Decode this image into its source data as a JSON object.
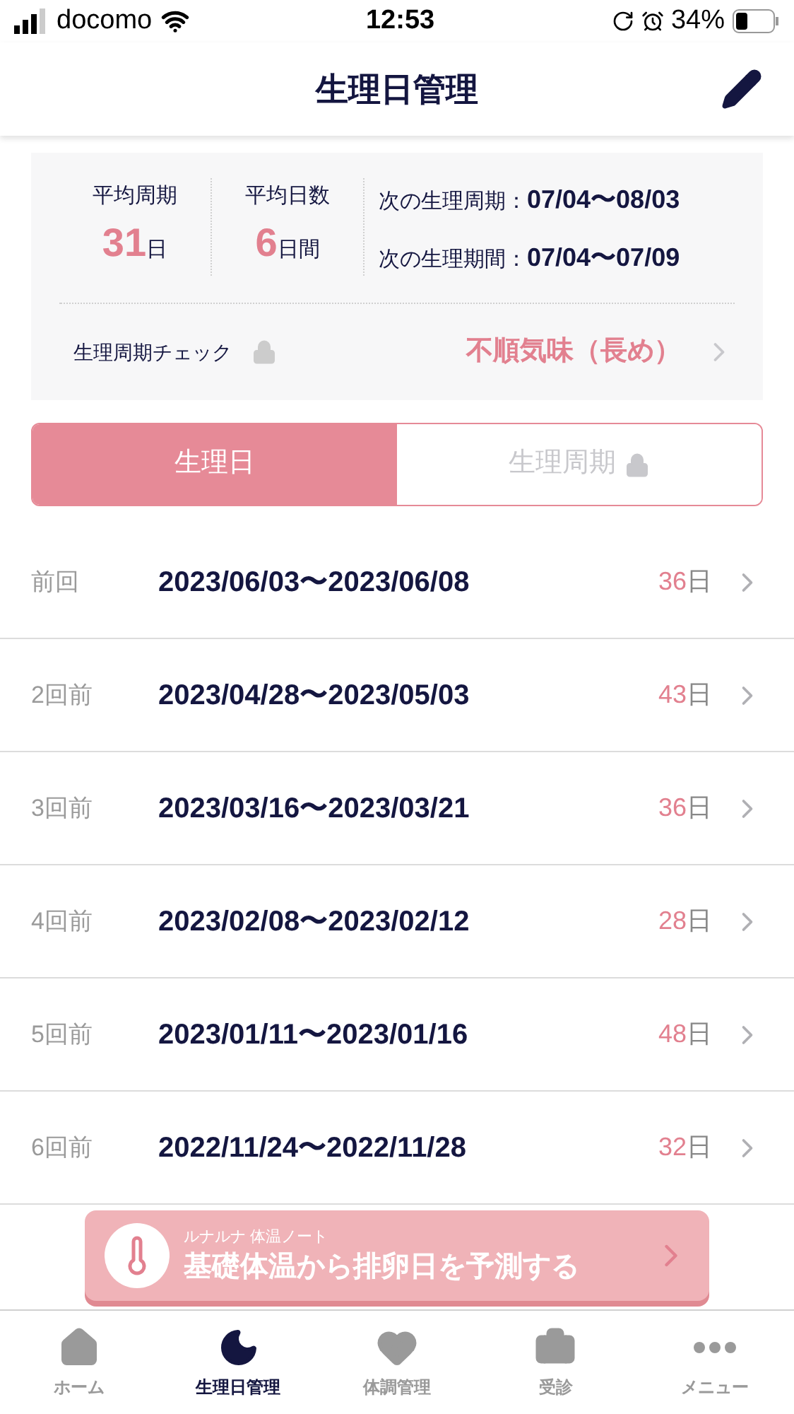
{
  "status_bar": {
    "carrier": "docomo",
    "time": "12:53",
    "battery": "34%"
  },
  "header": {
    "title": "生理日管理"
  },
  "summary": {
    "stats": [
      {
        "label": "平均周期",
        "value": "31",
        "unit": "日"
      },
      {
        "label": "平均日数",
        "value": "6",
        "unit": "日間"
      }
    ],
    "predictions": [
      {
        "label": "次の生理周期：",
        "value": "07/04〜08/03"
      },
      {
        "label": "次の生理期間：",
        "value": "07/04〜07/09"
      }
    ],
    "check": {
      "label": "生理周期チェック",
      "locked": true,
      "result": "不順気味（長め）"
    }
  },
  "tabs": [
    {
      "label": "生理日",
      "selected": true,
      "locked": false
    },
    {
      "label": "生理周期",
      "selected": false,
      "locked": true
    }
  ],
  "history": [
    {
      "label": "前回",
      "dates": "2023/06/03〜2023/06/08",
      "days": "36",
      "unit": "日"
    },
    {
      "label": "2回前",
      "dates": "2023/04/28〜2023/05/03",
      "days": "43",
      "unit": "日"
    },
    {
      "label": "3回前",
      "dates": "2023/03/16〜2023/03/21",
      "days": "36",
      "unit": "日"
    },
    {
      "label": "4回前",
      "dates": "2023/02/08〜2023/02/12",
      "days": "28",
      "unit": "日"
    },
    {
      "label": "5回前",
      "dates": "2023/01/11〜2023/01/16",
      "days": "48",
      "unit": "日"
    },
    {
      "label": "6回前",
      "dates": "2022/11/24〜2022/11/28",
      "days": "32",
      "unit": "日"
    }
  ],
  "banner": {
    "caption": "ルナルナ 体温ノート",
    "text": "基礎体温から排卵日を予測する"
  },
  "tab_bar": [
    {
      "kind": "home",
      "label": "ホーム",
      "selected": false
    },
    {
      "kind": "moon",
      "label": "生理日管理",
      "selected": true
    },
    {
      "kind": "heart",
      "label": "体調管理",
      "selected": false
    },
    {
      "kind": "clinic",
      "label": "受診",
      "selected": false
    },
    {
      "kind": "more",
      "label": "メニュー",
      "selected": false
    }
  ]
}
